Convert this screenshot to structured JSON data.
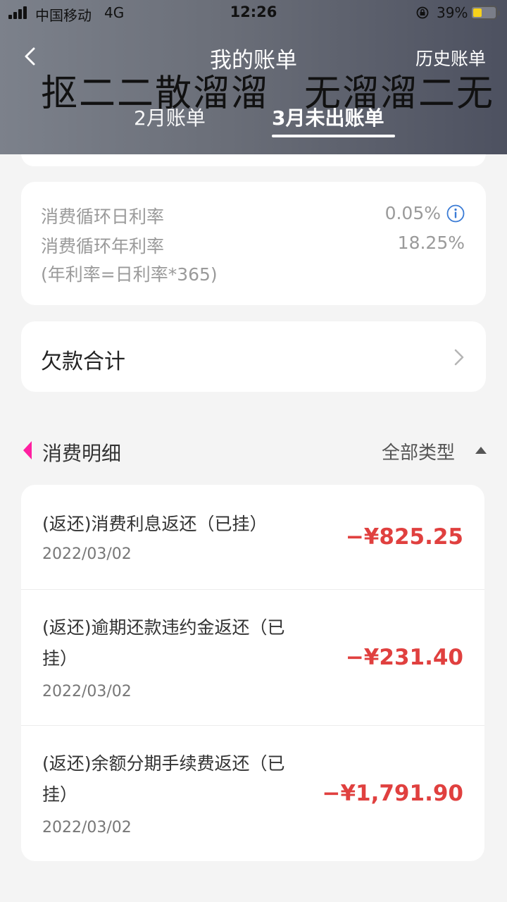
{
  "status_bar": {
    "carrier": "中国移动",
    "network": "4G",
    "time": "12:26",
    "battery": "39%",
    "battery_level": 0.39,
    "battery_color": "#f7d21b"
  },
  "header": {
    "title": "我的账单",
    "history_link": "历史账单",
    "obfuscated_left": "抠二二散溜溜",
    "obfuscated_right": "无溜溜二无",
    "tabs": [
      {
        "label": "2月账单",
        "active": false
      },
      {
        "label": "3月未出账单",
        "active": true
      }
    ]
  },
  "rates": {
    "daily_label": "消费循环日利率",
    "daily_value": "0.05%",
    "annual_label": "消费循环年利率",
    "annual_value": "18.25%",
    "formula_note": "(年利率=日利率*365)"
  },
  "debt": {
    "label": "欠款合计"
  },
  "details": {
    "section_title": "消费明细",
    "filter_label": "全部类型",
    "accent_color": "#ff1fa0",
    "amount_color": "#e0403f",
    "items": [
      {
        "desc_line1": "(返还)消费利息返还（已挂）",
        "desc_line2": "",
        "date": "2022/03/02",
        "amount": "−¥825.25"
      },
      {
        "desc_line1": "(返还)逾期还款违约金返还（已",
        "desc_line2": "挂）",
        "date": "2022/03/02",
        "amount": "−¥231.40"
      },
      {
        "desc_line1": "(返还)余额分期手续费返还（已",
        "desc_line2": "挂）",
        "date": "2022/03/02",
        "amount": "−¥1,791.90"
      }
    ]
  },
  "icons": {
    "back": "chevron-left-icon",
    "info": "info-circle-icon",
    "debt_arrow": "chevron-right-icon",
    "filter_caret": "caret-up-icon",
    "orientation_lock": "orientation-lock-icon"
  }
}
